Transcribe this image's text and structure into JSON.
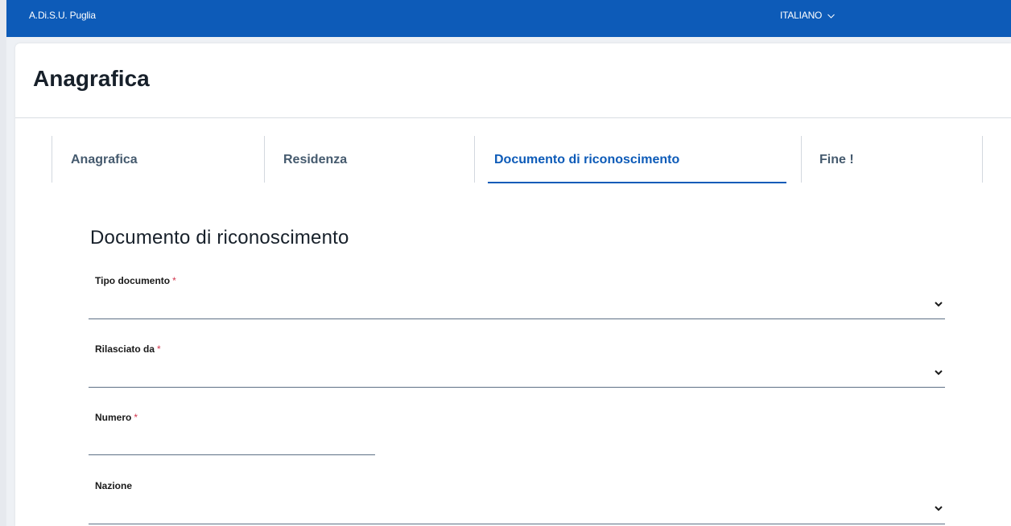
{
  "header": {
    "brand": "A.Di.S.U. Puglia",
    "language": "ITALIANO"
  },
  "page": {
    "title": "Anagrafica"
  },
  "tabs": [
    {
      "label": "Anagrafica",
      "active": false
    },
    {
      "label": "Residenza",
      "active": false
    },
    {
      "label": "Documento di riconoscimento",
      "active": true
    },
    {
      "label": "Fine !",
      "active": false
    }
  ],
  "form": {
    "section_title": "Documento di riconoscimento",
    "fields": [
      {
        "label": "Tipo documento",
        "required_mark": "*",
        "type": "select",
        "value": ""
      },
      {
        "label": "Rilasciato da",
        "required_mark": "*",
        "type": "select",
        "value": ""
      },
      {
        "label": "Numero",
        "required_mark": "*",
        "type": "text",
        "value": ""
      },
      {
        "label": "Nazione",
        "required_mark": "",
        "type": "select",
        "value": ""
      }
    ]
  },
  "colors": {
    "primary": "#0d5bb8",
    "required": "#d1344c",
    "tab_text": "#455a6e"
  },
  "icons": {
    "language_chevron": "chevron-down-icon",
    "select_chevron": "chevron-down-icon"
  }
}
